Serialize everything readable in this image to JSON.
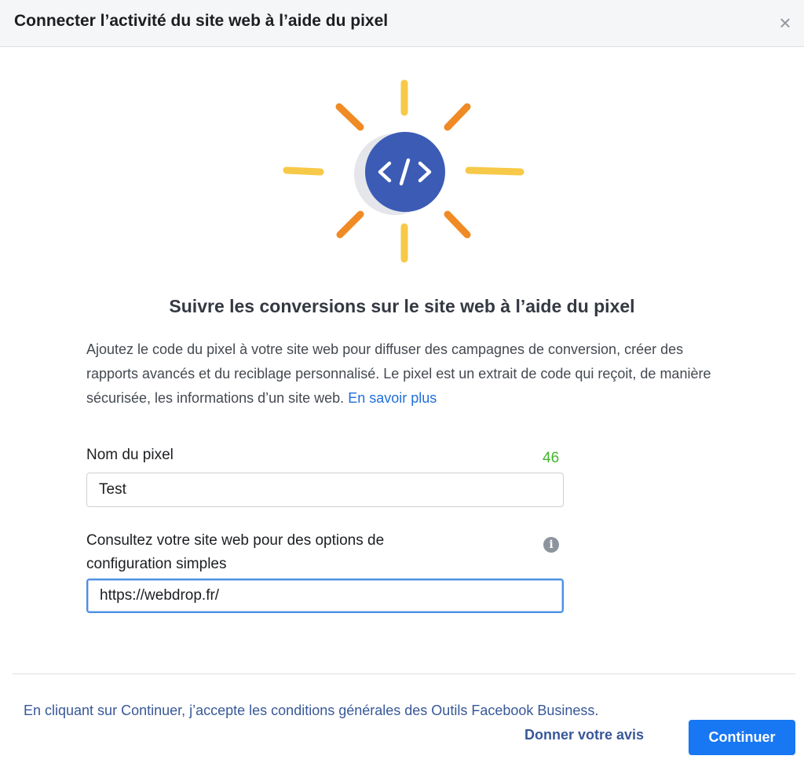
{
  "dialog": {
    "title": "Connecter l’activité du site web à l’aide du pixel",
    "close_icon": "×"
  },
  "hero": {
    "icon": "code-icon",
    "circle_color": "#3b5bb5",
    "ray_yellow": "#f7c948",
    "ray_orange": "#f08a24"
  },
  "content": {
    "heading": "Suivre les conversions sur le site web à l’aide du pixel",
    "description": "Ajoutez le code du pixel à votre site web pour diffuser des campagnes de conversion, créer des rapports avancés et du reciblage personnalisé. Le pixel est un extrait de code qui reçoit, de manière sécurisée, les informations d’un site web.",
    "learn_more": "En savoir plus"
  },
  "form": {
    "pixel_name_label": "Nom du pixel",
    "pixel_name_counter": "46",
    "pixel_name_value": "Test",
    "website_label_line1": "Consultez votre site web pour des options de",
    "website_label_line2": "configuration simples",
    "website_value": "https://webdrop.fr/",
    "info_icon": "i"
  },
  "footer": {
    "terms": "En cliquant sur Continuer, j’accepte les conditions générales des Outils Facebook Business.",
    "feedback_label": "Donner votre avis",
    "continue_label": "Continuer"
  }
}
